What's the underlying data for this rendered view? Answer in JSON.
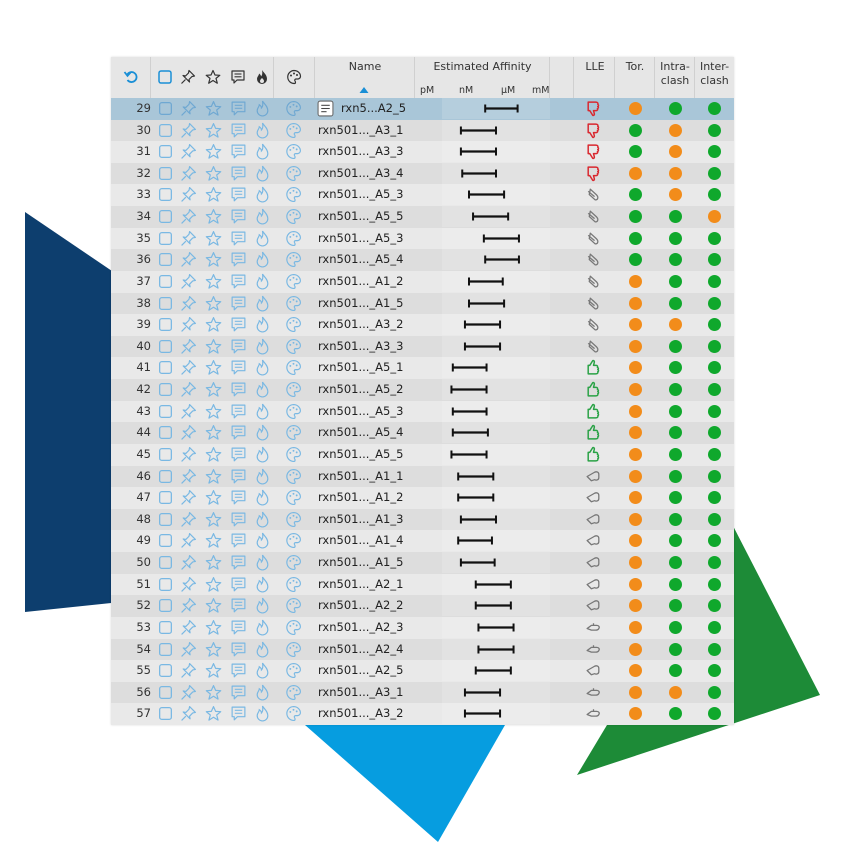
{
  "header": {
    "name_label": "Name",
    "affinity_label": "Estimated Affinity",
    "affinity_units": [
      "pM",
      "nM",
      "µM",
      "mM"
    ],
    "lle_label": "LLE",
    "tor_label": "Tor.",
    "intra_label_1": "Intra-",
    "intra_label_2": "clash",
    "inter_label_1": "Inter-",
    "inter_label_2": "clash"
  },
  "colors": {
    "orange": "#f28c1a",
    "green": "#0fa82c",
    "dark_blue": "#0d3e6e",
    "light_blue": "#069de0",
    "deco_green": "#1d8b37",
    "icon_blue": "#79b8e3",
    "selected_row": "#a9c6d8"
  },
  "rows": [
    {
      "num": "29",
      "name": "rxn5...A2_5",
      "selected": true,
      "lle": "bad",
      "tor": "orange",
      "intra": "green",
      "inter": "green",
      "aff": [
        0.52,
        0.76
      ]
    },
    {
      "num": "30",
      "name": "rxn501..._A3_1",
      "lle": "bad",
      "tor": "green",
      "intra": "orange",
      "inter": "green",
      "aff": [
        0.34,
        0.6
      ]
    },
    {
      "num": "31",
      "name": "rxn501..._A3_3",
      "lle": "bad",
      "tor": "green",
      "intra": "orange",
      "inter": "green",
      "aff": [
        0.34,
        0.6
      ]
    },
    {
      "num": "32",
      "name": "rxn501..._A3_4",
      "lle": "bad",
      "tor": "orange",
      "intra": "orange",
      "inter": "green",
      "aff": [
        0.35,
        0.6
      ]
    },
    {
      "num": "33",
      "name": "rxn501..._A5_3",
      "lle": "neutral",
      "tor": "green",
      "intra": "orange",
      "inter": "green",
      "aff": [
        0.4,
        0.66
      ]
    },
    {
      "num": "34",
      "name": "rxn501..._A5_5",
      "lle": "neutral",
      "tor": "green",
      "intra": "green",
      "inter": "orange",
      "aff": [
        0.43,
        0.69
      ]
    },
    {
      "num": "35",
      "name": "rxn501..._A5_3",
      "lle": "neutral",
      "tor": "green",
      "intra": "green",
      "inter": "green",
      "aff": [
        0.51,
        0.77
      ]
    },
    {
      "num": "36",
      "name": "rxn501..._A5_4",
      "lle": "neutral",
      "tor": "green",
      "intra": "green",
      "inter": "green",
      "aff": [
        0.52,
        0.77
      ]
    },
    {
      "num": "37",
      "name": "rxn501..._A1_2",
      "lle": "neutral",
      "tor": "orange",
      "intra": "green",
      "inter": "green",
      "aff": [
        0.4,
        0.65
      ]
    },
    {
      "num": "38",
      "name": "rxn501..._A1_5",
      "lle": "neutral",
      "tor": "orange",
      "intra": "green",
      "inter": "green",
      "aff": [
        0.4,
        0.66
      ]
    },
    {
      "num": "39",
      "name": "rxn501..._A3_2",
      "lle": "neutral",
      "tor": "orange",
      "intra": "orange",
      "inter": "green",
      "aff": [
        0.37,
        0.63
      ]
    },
    {
      "num": "40",
      "name": "rxn501..._A3_3",
      "lle": "neutral",
      "tor": "orange",
      "intra": "green",
      "inter": "green",
      "aff": [
        0.37,
        0.63
      ]
    },
    {
      "num": "41",
      "name": "rxn501..._A5_1",
      "lle": "good",
      "tor": "orange",
      "intra": "green",
      "inter": "green",
      "aff": [
        0.28,
        0.53
      ]
    },
    {
      "num": "42",
      "name": "rxn501..._A5_2",
      "lle": "good",
      "tor": "orange",
      "intra": "green",
      "inter": "green",
      "aff": [
        0.27,
        0.53
      ]
    },
    {
      "num": "43",
      "name": "rxn501..._A5_3",
      "lle": "good",
      "tor": "orange",
      "intra": "green",
      "inter": "green",
      "aff": [
        0.28,
        0.53
      ]
    },
    {
      "num": "44",
      "name": "rxn501..._A5_4",
      "lle": "good",
      "tor": "orange",
      "intra": "green",
      "inter": "green",
      "aff": [
        0.28,
        0.54
      ]
    },
    {
      "num": "45",
      "name": "rxn501..._A5_5",
      "lle": "good",
      "tor": "orange",
      "intra": "green",
      "inter": "green",
      "aff": [
        0.27,
        0.53
      ]
    },
    {
      "num": "46",
      "name": "rxn501..._A1_1",
      "lle": "mid",
      "tor": "orange",
      "intra": "green",
      "inter": "green",
      "aff": [
        0.32,
        0.58
      ]
    },
    {
      "num": "47",
      "name": "rxn501..._A1_2",
      "lle": "mid",
      "tor": "orange",
      "intra": "green",
      "inter": "green",
      "aff": [
        0.32,
        0.58
      ]
    },
    {
      "num": "48",
      "name": "rxn501..._A1_3",
      "lle": "mid",
      "tor": "orange",
      "intra": "green",
      "inter": "green",
      "aff": [
        0.34,
        0.6
      ]
    },
    {
      "num": "49",
      "name": "rxn501..._A1_4",
      "lle": "mid",
      "tor": "orange",
      "intra": "green",
      "inter": "green",
      "aff": [
        0.32,
        0.57
      ]
    },
    {
      "num": "50",
      "name": "rxn501..._A1_5",
      "lle": "mid",
      "tor": "orange",
      "intra": "green",
      "inter": "green",
      "aff": [
        0.34,
        0.59
      ]
    },
    {
      "num": "51",
      "name": "rxn501..._A2_1",
      "lle": "mid",
      "tor": "orange",
      "intra": "green",
      "inter": "green",
      "aff": [
        0.45,
        0.71
      ]
    },
    {
      "num": "52",
      "name": "rxn501..._A2_2",
      "lle": "mid",
      "tor": "orange",
      "intra": "green",
      "inter": "green",
      "aff": [
        0.45,
        0.71
      ]
    },
    {
      "num": "53",
      "name": "rxn501..._A2_3",
      "lle": "mid2",
      "tor": "orange",
      "intra": "green",
      "inter": "green",
      "aff": [
        0.47,
        0.73
      ]
    },
    {
      "num": "54",
      "name": "rxn501..._A2_4",
      "lle": "mid2",
      "tor": "orange",
      "intra": "green",
      "inter": "green",
      "aff": [
        0.47,
        0.73
      ]
    },
    {
      "num": "55",
      "name": "rxn501..._A2_5",
      "lle": "mid",
      "tor": "orange",
      "intra": "green",
      "inter": "green",
      "aff": [
        0.45,
        0.71
      ]
    },
    {
      "num": "56",
      "name": "rxn501..._A3_1",
      "lle": "mid2",
      "tor": "orange",
      "intra": "orange",
      "inter": "green",
      "aff": [
        0.37,
        0.63
      ]
    },
    {
      "num": "57",
      "name": "rxn501..._A3_2",
      "lle": "mid2",
      "tor": "orange",
      "intra": "green",
      "inter": "green",
      "aff": [
        0.37,
        0.63
      ]
    }
  ]
}
